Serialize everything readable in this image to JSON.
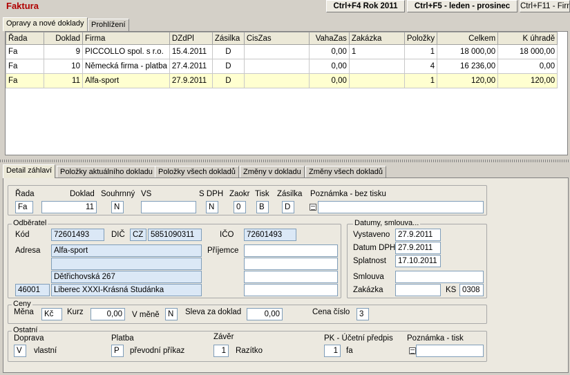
{
  "header": {
    "title": "Faktura",
    "btn_year": "Ctrl+F4 Rok 2011",
    "btn_period": "Ctrl+F5 - leden - prosinec",
    "btn_firm": "Ctrl+F11 - Firm"
  },
  "top_tabs": [
    "Opravy a nové doklady",
    "Prohlížení"
  ],
  "grid": {
    "columns": [
      "Řada",
      "Doklad",
      "Firma",
      "DZdPl",
      "Zásilka",
      "CisZas",
      "VahaZas",
      "Zakázka",
      "Položky",
      "Celkem",
      "K úhradě"
    ],
    "rows": [
      [
        "Fa",
        "9",
        "PICCOLLO spol. s r.o.",
        "15.4.2011",
        "D",
        "",
        "0,00",
        "1",
        "1",
        "18 000,00",
        "18 000,00"
      ],
      [
        "Fa",
        "10",
        "Německá firma - platba",
        "27.4.2011",
        "D",
        "",
        "0,00",
        "",
        "4",
        "16 236,00",
        "0,00"
      ],
      [
        "Fa",
        "11",
        "Alfa-sport",
        "27.9.2011",
        "D",
        "",
        "0,00",
        "",
        "1",
        "120,00",
        "120,00"
      ]
    ]
  },
  "bottom_tabs": [
    "Detail záhlaví",
    "Položky aktuálního dokladu",
    "Položky všech dokladů",
    "Změny v dokladu",
    "Změny všech dokladů"
  ],
  "form": {
    "row1": {
      "labels": {
        "rada": "Řada",
        "doklad": "Doklad",
        "souhrnny": "Souhrnný",
        "vs": "VS",
        "sdph": "S DPH",
        "zaokr": "Zaokr",
        "tisk": "Tisk",
        "zasilka": "Zásilka",
        "poznamka": "Poznámka - bez tisku"
      },
      "values": {
        "rada": "Fa",
        "doklad": "11",
        "souhrnny": "N",
        "vs": "",
        "sdph": "N",
        "zaokr": "0",
        "tisk": "B",
        "zasilka": "D",
        "poznamka": ""
      }
    },
    "odberatel": {
      "title": "Odběratel",
      "kod_label": "Kód",
      "kod": "72601493",
      "dic_label": "DIČ",
      "dic_prefix": "CZ",
      "dic": "5851090311",
      "ico_label": "IČO",
      "ico": "72601493",
      "adresa_label": "Adresa",
      "adresa": [
        "Alfa-sport",
        "",
        "Dětřichovská 267"
      ],
      "psc": "46001",
      "mesto": "Liberec XXXI-Krásná Studánka",
      "prijemce_label": "Příjemce",
      "prijemce": [
        "",
        "",
        "",
        ""
      ]
    },
    "datumy": {
      "title": "Datumy, smlouva...",
      "vystaveno_label": "Vystaveno",
      "vystaveno": "27.9.2011",
      "datum_dph_label": "Datum DPH",
      "datum_dph": "27.9.2011",
      "splatnost_label": "Splatnost",
      "splatnost": "17.10.2011",
      "smlouva_label": "Smlouva",
      "smlouva": "",
      "zakazka_label": "Zakázka",
      "zakazka": "",
      "ks_label": "KS",
      "ks": "0308"
    },
    "ceny": {
      "title": "Ceny",
      "mena_label": "Měna",
      "mena": "Kč",
      "kurz_label": "Kurz",
      "kurz": "0,00",
      "vmene_label": "V měně",
      "vmene": "N",
      "sleva_label": "Sleva za doklad",
      "sleva": "0,00",
      "cena_cislo_label": "Cena číslo",
      "cena_cislo": "3"
    },
    "ostatni": {
      "title": "Ostatní",
      "doprava_label": "Doprava",
      "doprava_code": "V",
      "doprava_text": "vlastní",
      "platba_label": "Platba",
      "platba_code": "P",
      "platba_text": "převodní příkaz",
      "zaver_label": "Závěr",
      "zaver_code": "1",
      "zaver_text": "Razítko",
      "pk_label": "PK - Účetní předpis",
      "pk_code": "1",
      "pk_text": "fa",
      "pozn_tisk_label": "Poznámka - tisk",
      "pozn_tisk": ""
    }
  },
  "colors": {
    "title": "#b00000",
    "selected_row": "#ffffd0",
    "readonly_field": "#dbe8f6"
  }
}
